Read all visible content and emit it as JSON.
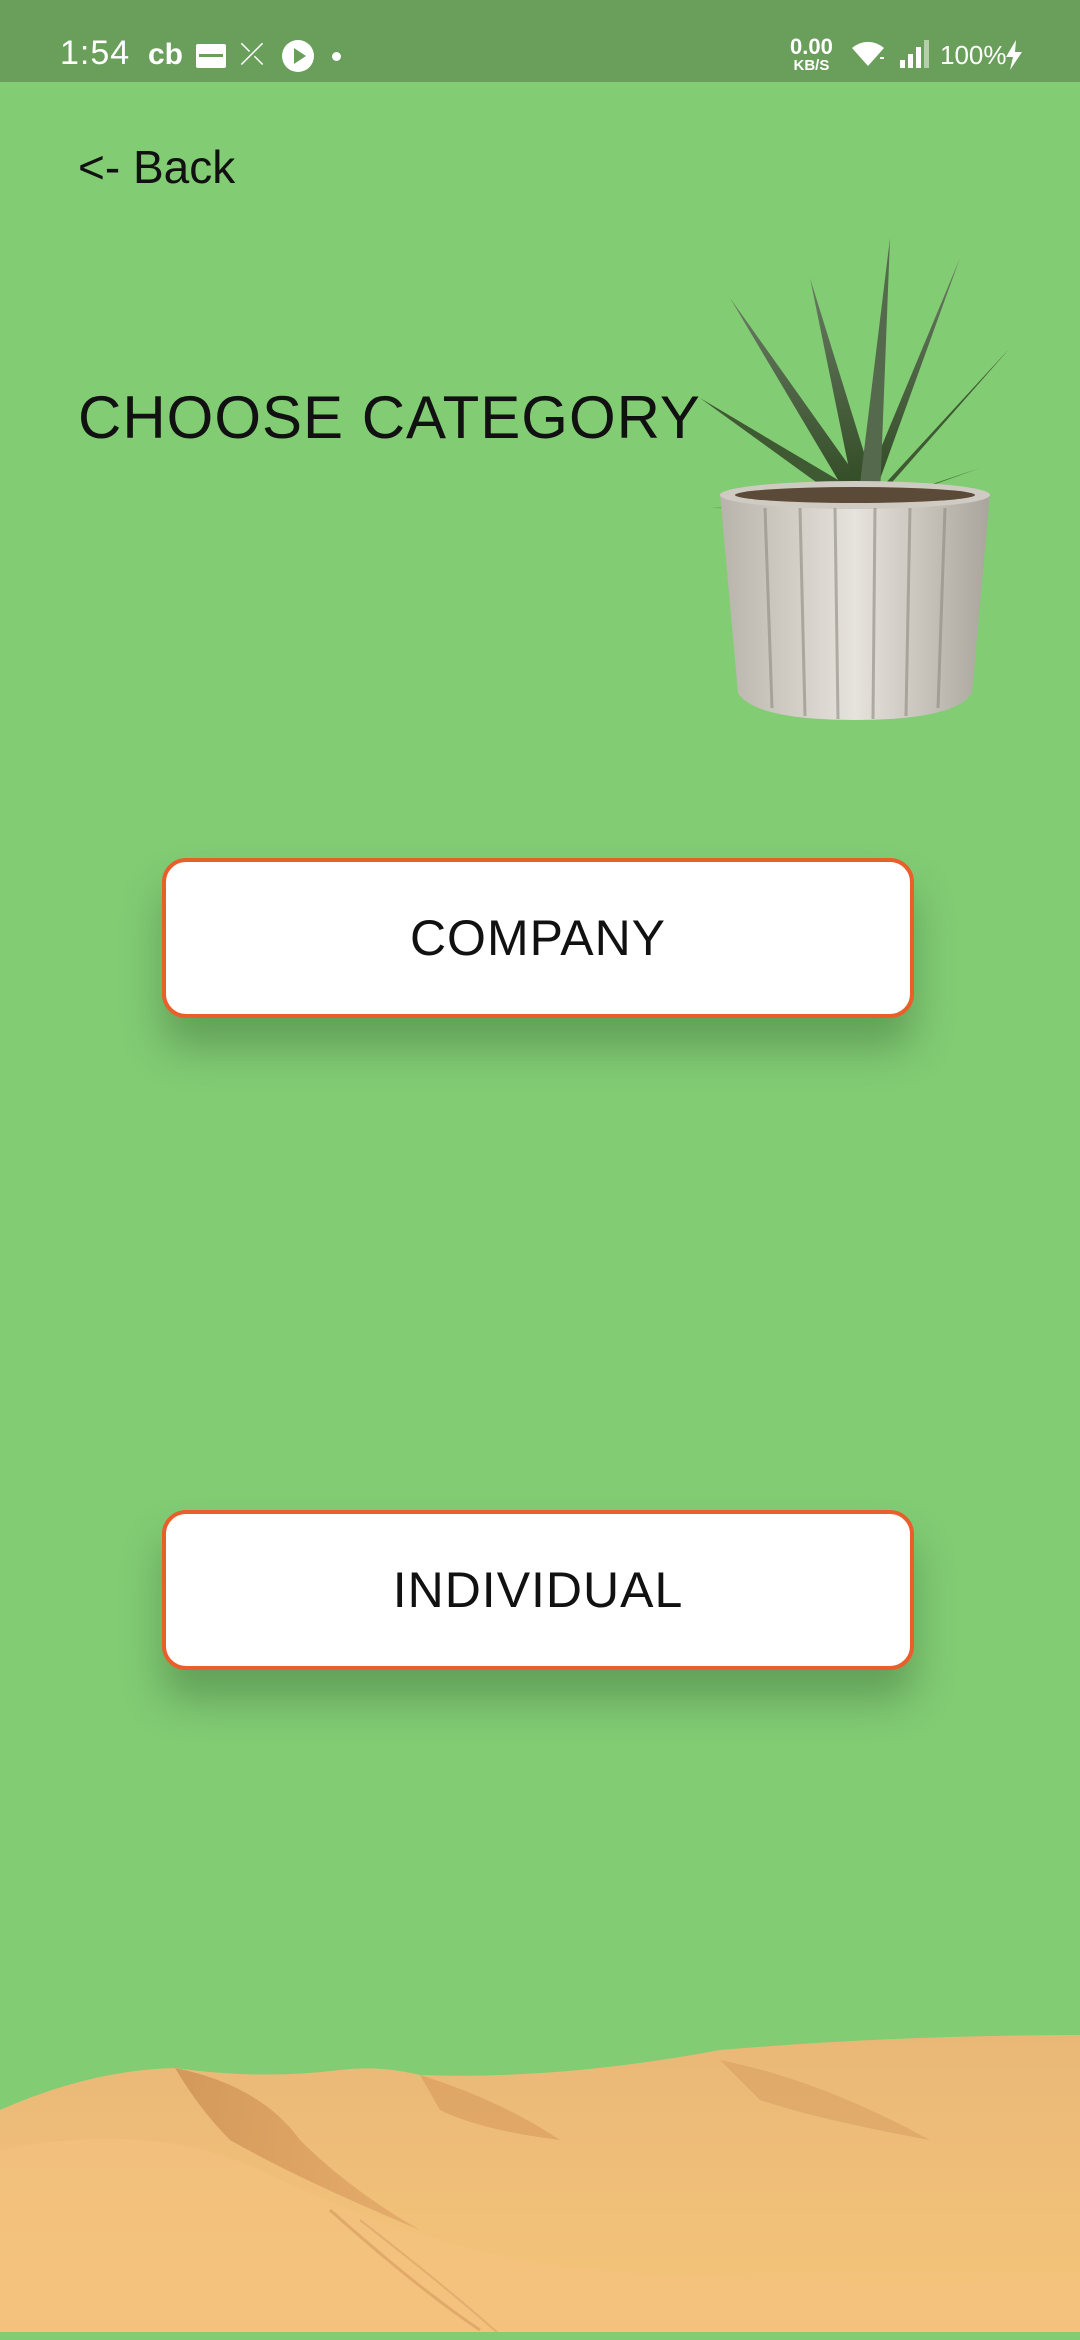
{
  "status_bar": {
    "time": "1:54",
    "cb_label": "cb",
    "network_speed_value": "0.00",
    "network_speed_unit": "KB/S",
    "battery": "100%",
    "icons": [
      "cb-icon",
      "card-icon",
      "missed-call-icon",
      "play-icon",
      "dot-icon",
      "wifi-icon",
      "signal-icon",
      "charging-icon"
    ]
  },
  "navigation": {
    "back_label": "<- Back"
  },
  "header": {
    "title": "CHOOSE CATEGORY",
    "image": "potted-succulent-plant"
  },
  "categories": [
    {
      "label": "COMPANY"
    },
    {
      "label": "INDIVIDUAL"
    }
  ],
  "footer": {
    "image": "desert-dunes"
  },
  "colors": {
    "background": "#82cc74",
    "status_bar": "#6a9e5b",
    "button_border": "#e85f2c",
    "button_fill": "#ffffff",
    "sand": "#f2b86a"
  }
}
